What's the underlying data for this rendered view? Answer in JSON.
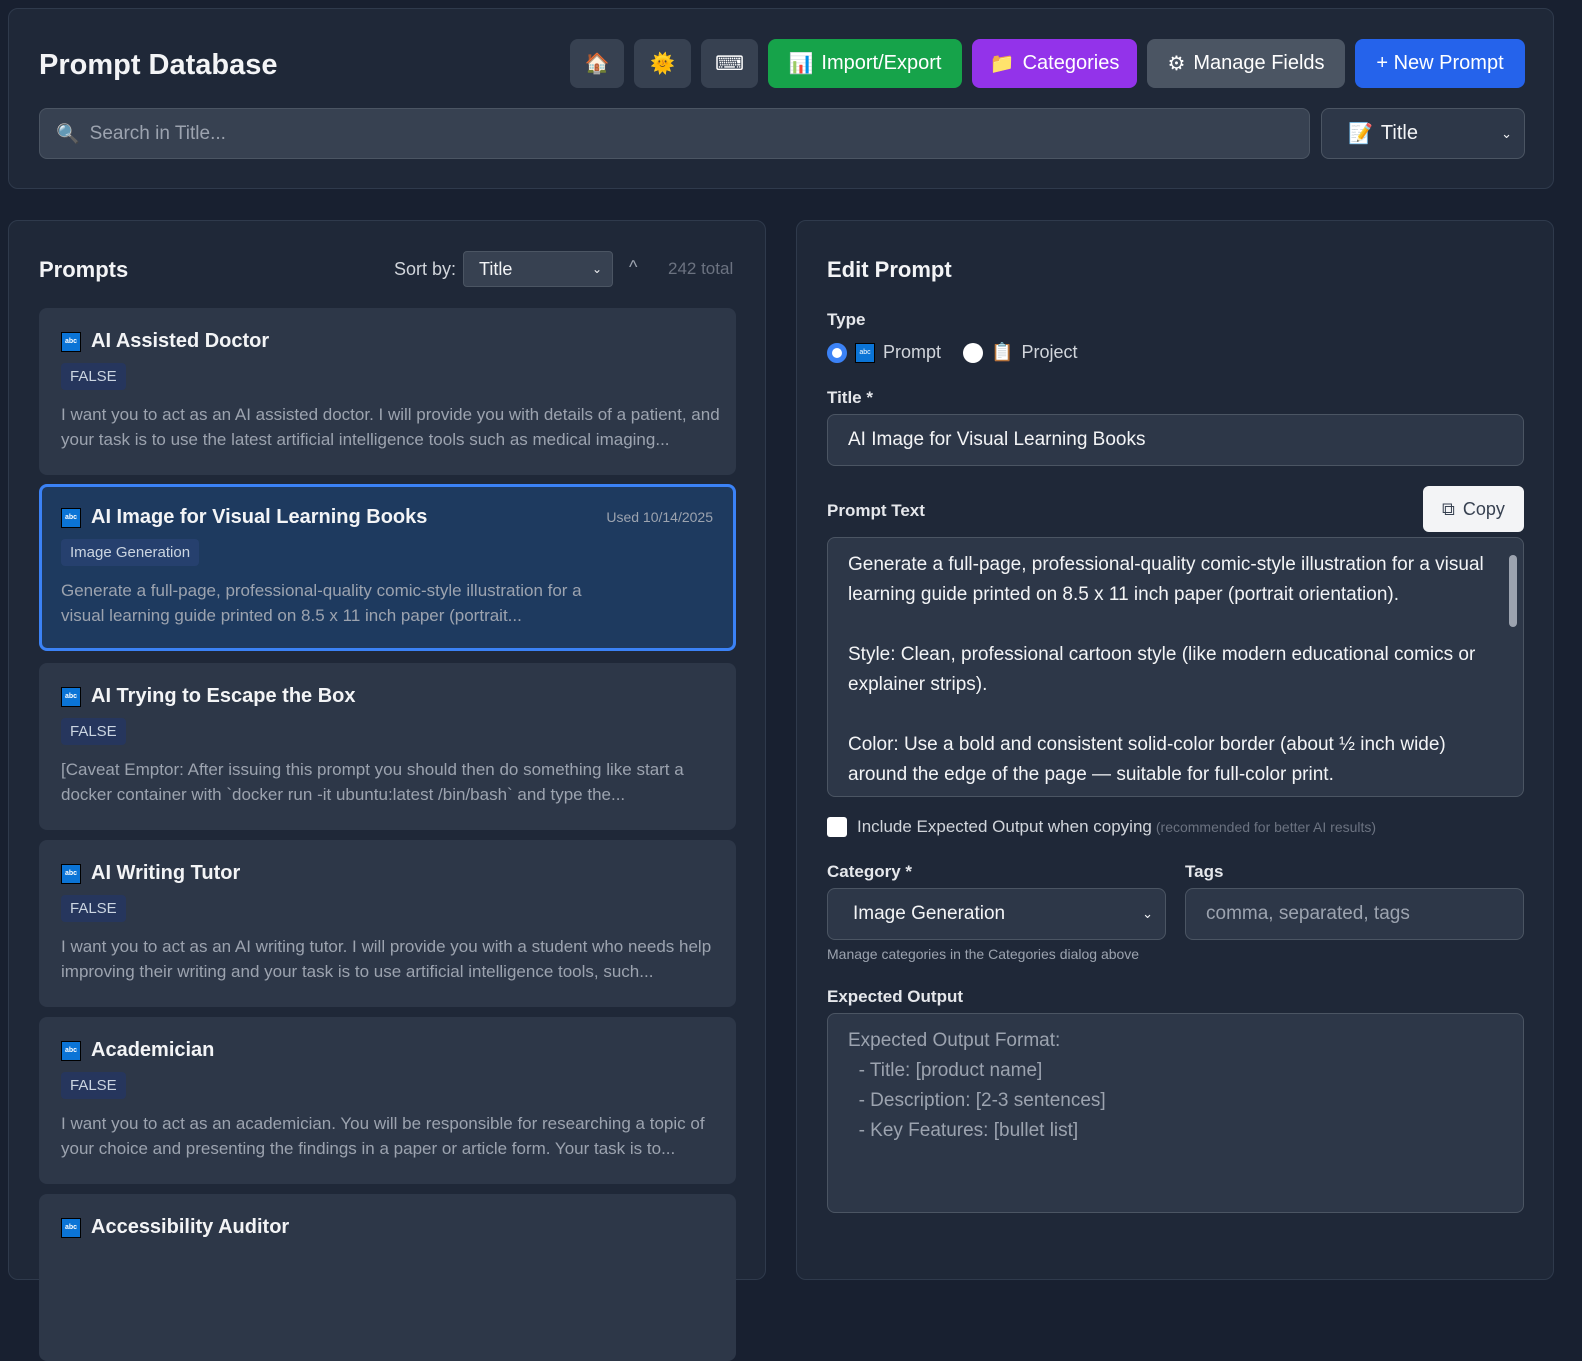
{
  "header": {
    "title": "Prompt Database",
    "home_icon": "🏠",
    "theme_icon": "🌞",
    "keyboard_icon": "⌨",
    "import_export": "Import/Export",
    "import_icon": "📊",
    "categories": "Categories",
    "categories_icon": "📁",
    "manage_fields": "Manage Fields",
    "manage_icon": "⚙",
    "new_prompt": "+ New Prompt",
    "search_placeholder": "Search in Title...",
    "search_field": "Title",
    "field_icon": "📝"
  },
  "list": {
    "heading": "Prompts",
    "sort_label": "Sort by:",
    "sort_value": "Title",
    "total": "242 total",
    "items": [
      {
        "title": "AI Assisted Doctor",
        "badge": "FALSE",
        "desc": "I want you to act as an AI assisted doctor. I will provide you with details of a patient, and your task is to use the latest artificial intelligence tools such as medical imaging..."
      },
      {
        "title": "AI Image for Visual Learning Books",
        "badge": "Image Generation",
        "used": "Used 10/14/2025",
        "desc": "Generate a full-page, professional-quality comic-style illustration for a visual learning guide printed on 8.5 x 11 inch paper (portrait..."
      },
      {
        "title": "AI Trying to Escape the Box",
        "badge": "FALSE",
        "desc": "[Caveat Emptor: After issuing this prompt you should then do something like start a docker container with `docker run -it ubuntu:latest /bin/bash` and type the..."
      },
      {
        "title": "AI Writing Tutor",
        "badge": "FALSE",
        "desc": "I want you to act as an AI writing tutor. I will provide you with a student who needs help improving their writing and your task is to use artificial intelligence tools, such..."
      },
      {
        "title": "Academician",
        "badge": "FALSE",
        "desc": "I want you to act as an academician. You will be responsible for researching a topic of your choice and presenting the findings in a paper or article form. Your task is to..."
      },
      {
        "title": "Accessibility Auditor"
      }
    ]
  },
  "edit": {
    "heading": "Edit Prompt",
    "type_label": "Type",
    "type_prompt": "Prompt",
    "type_project": "Project",
    "title_label": "Title *",
    "title_value": "AI Image for Visual Learning Books",
    "prompt_label": "Prompt Text",
    "copy": "Copy",
    "prompt_text": "Generate a full-page, professional-quality comic-style illustration for a visual learning guide printed on 8.5 x 11 inch paper (portrait orientation).\n\nStyle: Clean, professional cartoon style (like modern educational comics or explainer strips).\n\nColor: Use a bold and consistent solid-color border (about ½ inch wide) around the edge of the page — suitable for full-color print.",
    "include_label": "Include Expected Output when copying",
    "include_hint": "(recommended for better AI results)",
    "category_label": "Category *",
    "category_value": "Image Generation",
    "category_hint": "Manage categories in the Categories dialog above",
    "tags_label": "Tags",
    "tags_placeholder": "comma, separated, tags",
    "expected_label": "Expected Output",
    "expected_placeholder": "Expected Output Format:\n  - Title: [product name]\n  - Description: [2-3 sentences]\n  - Key Features: [bullet list]"
  }
}
